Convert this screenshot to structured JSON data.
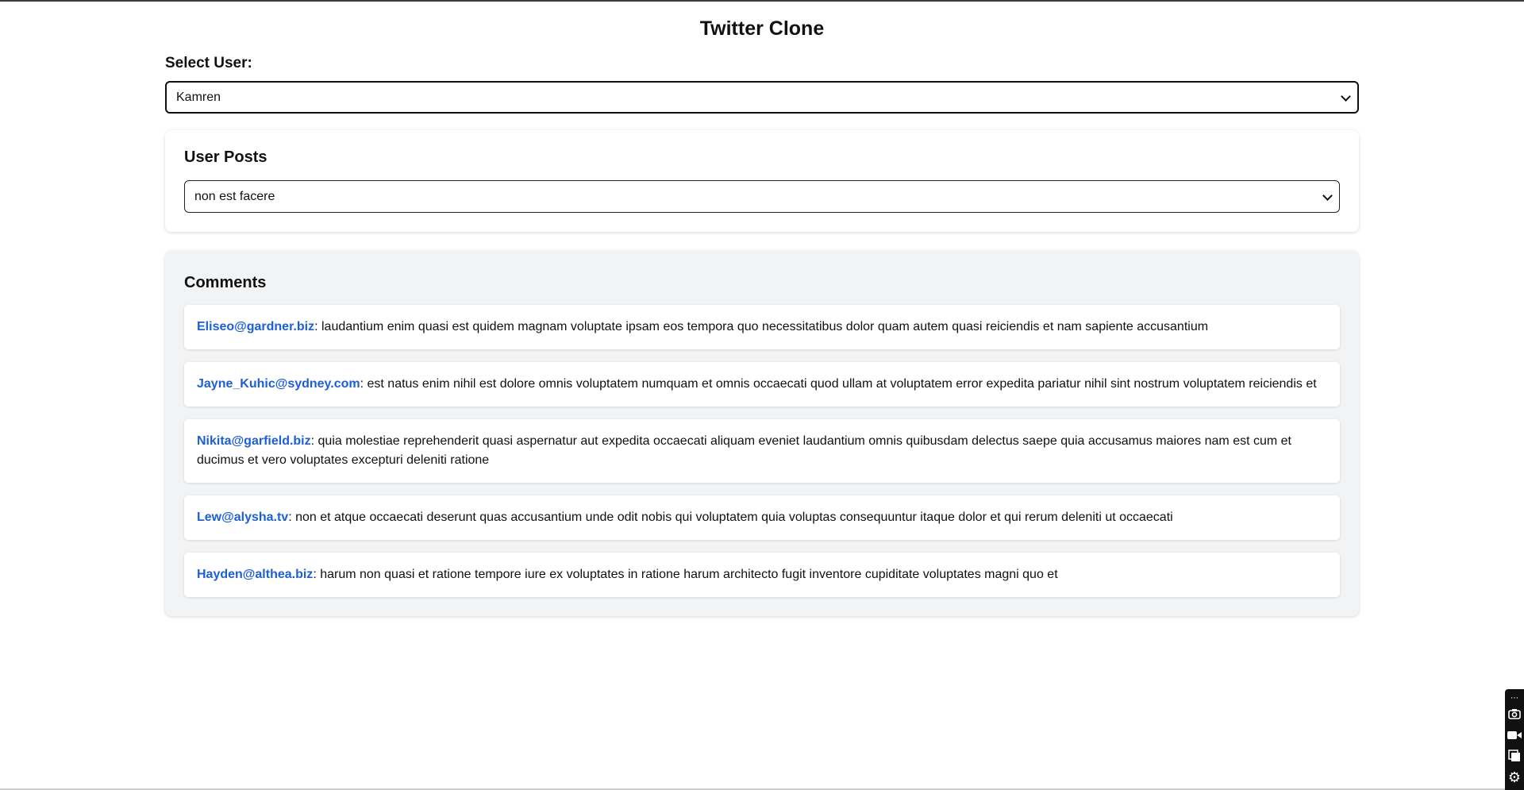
{
  "app": {
    "title": "Twitter Clone"
  },
  "user_selector": {
    "label": "Select User:",
    "selected": "Kamren"
  },
  "posts": {
    "heading": "User Posts",
    "selected": "non est facere"
  },
  "comments": {
    "heading": "Comments",
    "items": [
      {
        "email": "Eliseo@gardner.biz",
        "body": "laudantium enim quasi est quidem magnam voluptate ipsam eos tempora quo necessitatibus dolor quam autem quasi reiciendis et nam sapiente accusantium"
      },
      {
        "email": "Jayne_Kuhic@sydney.com",
        "body": "est natus enim nihil est dolore omnis voluptatem numquam et omnis occaecati quod ullam at voluptatem error expedita pariatur nihil sint nostrum voluptatem reiciendis et"
      },
      {
        "email": "Nikita@garfield.biz",
        "body": "quia molestiae reprehenderit quasi aspernatur aut expedita occaecati aliquam eveniet laudantium omnis quibusdam delectus saepe quia accusamus maiores nam est cum et ducimus et vero voluptates excepturi deleniti ratione"
      },
      {
        "email": "Lew@alysha.tv",
        "body": "non et atque occaecati deserunt quas accusantium unde odit nobis qui voluptatem quia voluptas consequuntur itaque dolor et qui rerum deleniti ut occaecati"
      },
      {
        "email": "Hayden@althea.biz",
        "body": "harum non quasi et ratione tempore iure ex voluptates in ratione harum architecto fugit inventore cupiditate voluptates magni quo et"
      }
    ]
  },
  "colors": {
    "email_link": "#1d5fd6",
    "comments_panel_bg": "#f2f3f5"
  },
  "extension_toolbar": {
    "icons": [
      "link-icon",
      "camera-icon",
      "video-icon",
      "windows-icon",
      "gear-icon"
    ]
  }
}
